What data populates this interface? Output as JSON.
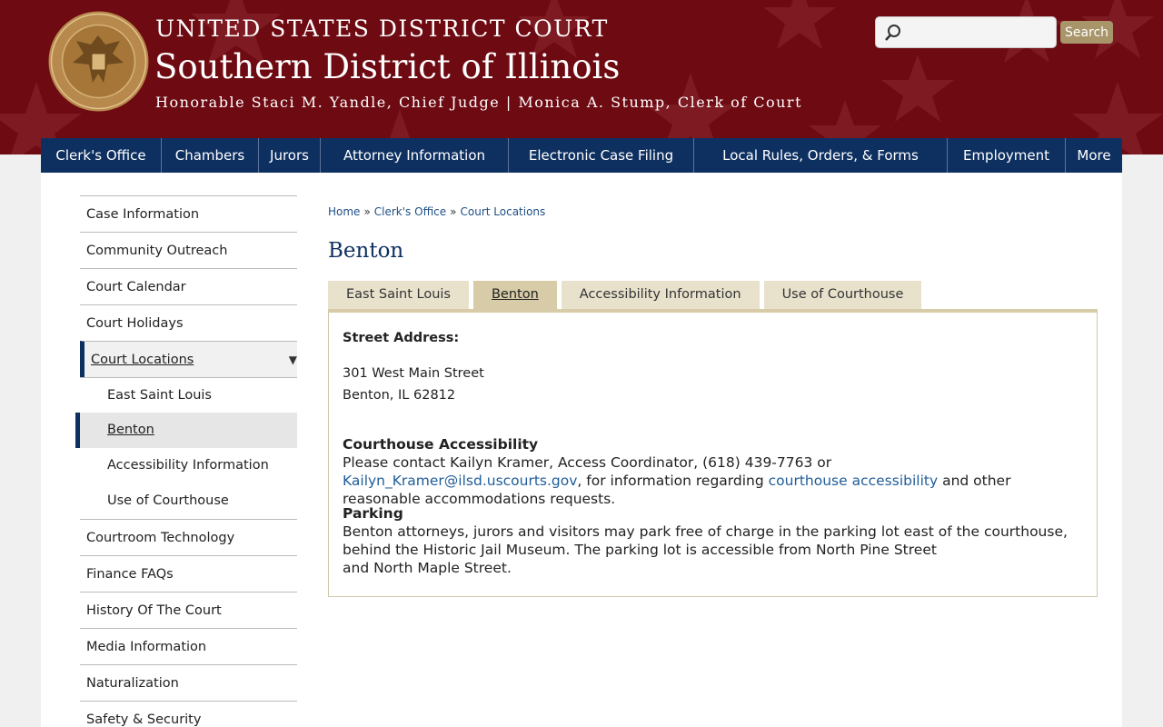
{
  "header": {
    "court": "UNITED STATES DISTRICT COURT",
    "district": "Southern District of Illinois",
    "officials": "Honorable Staci M. Yandle, Chief Judge | Monica A. Stump, Clerk of Court",
    "seal_icon": "court-seal",
    "colors": {
      "header_bg": "#6e0a12",
      "nav_bg": "#0e3061",
      "accent_tan": "#d7cca7",
      "link": "#1f5d99"
    }
  },
  "search": {
    "placeholder": "",
    "button": "Search",
    "icon": "magnifier-icon"
  },
  "nav": [
    "Clerk's Office",
    "Chambers",
    "Jurors",
    "Attorney Information",
    "Electronic Case Filing",
    "Local Rules, Orders, & Forms",
    "Employment",
    "More"
  ],
  "sidebar": {
    "items_top": [
      "Case Information",
      "Community Outreach",
      "Court Calendar",
      "Court Holidays"
    ],
    "active": "Court Locations",
    "subitems": [
      "East Saint Louis",
      "Benton",
      "Accessibility Information",
      "Use of Courthouse"
    ],
    "items_bottom": [
      "Courtroom Technology",
      "Finance FAQs",
      "History Of The Court",
      "Media Information",
      "Naturalization",
      "Safety & Security"
    ]
  },
  "breadcrumb": [
    "Home",
    "Clerk's Office",
    "Court Locations"
  ],
  "page_title": "Benton",
  "tabs": [
    "East Saint Louis",
    "Benton",
    "Accessibility Information",
    "Use of Courthouse"
  ],
  "panel": {
    "street_label": "Street Address:",
    "addr1": "301 West Main Street",
    "addr2": "Benton, IL 62812",
    "access_heading": "Courthouse Accessibility",
    "access_text1": "Please contact Kailyn Kramer, Access Coordinator, (618) 439-7763 or ",
    "access_email": "Kailyn_Kramer@ilsd.uscourts.gov",
    "access_text2": ", for information regarding ",
    "access_link": "courthouse accessibility",
    "access_text3": " and other reasonable accommodations requests.",
    "parking_heading": "Parking",
    "parking_line1": "Benton attorneys, jurors and visitors may park free of charge in the parking lot east of the courthouse,",
    "parking_line2": "behind the Historic Jail Museum. The parking lot is accessible from North Pine Street",
    "parking_line3": "and North Maple Street."
  }
}
